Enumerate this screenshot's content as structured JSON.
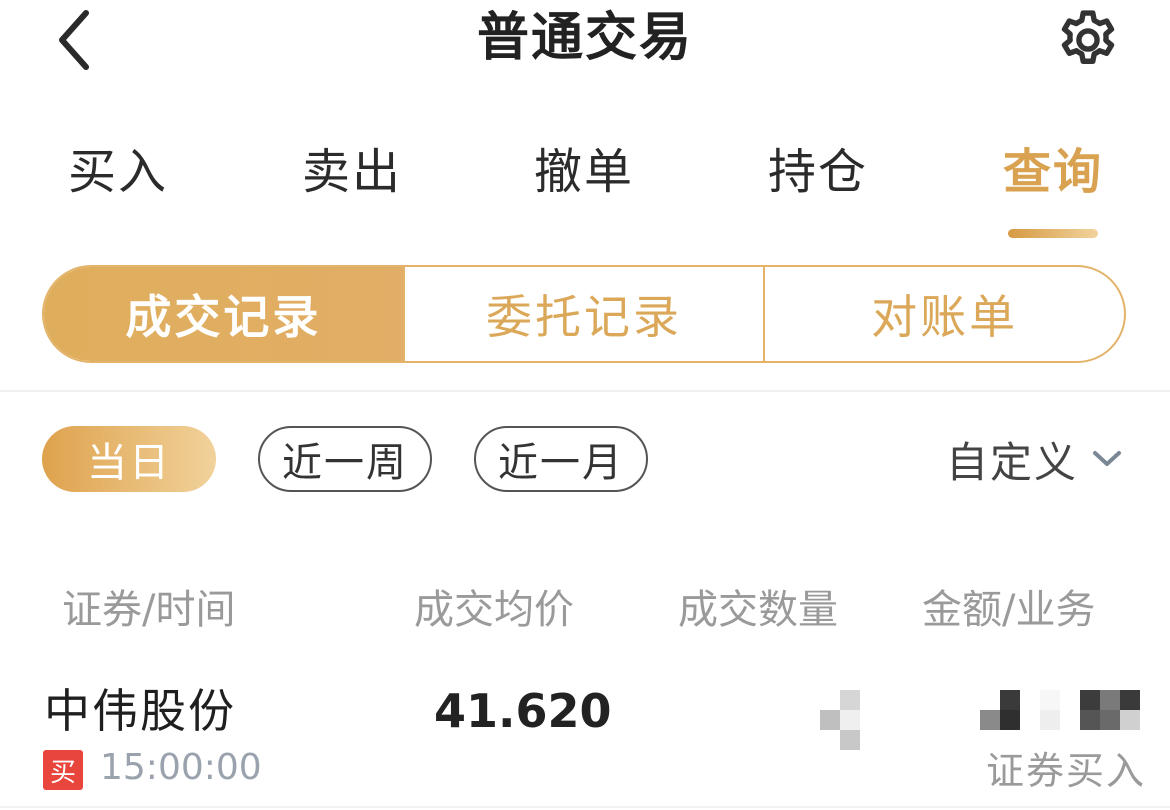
{
  "header": {
    "title": "普通交易",
    "back_icon": "chevron-left-icon",
    "settings_icon": "gear-icon"
  },
  "main_tabs": [
    {
      "label": "买入",
      "active": false
    },
    {
      "label": "卖出",
      "active": false
    },
    {
      "label": "撤单",
      "active": false
    },
    {
      "label": "持仓",
      "active": false
    },
    {
      "label": "查询",
      "active": true
    }
  ],
  "sub_tabs": [
    {
      "label": "成交记录",
      "active": true
    },
    {
      "label": "委托记录",
      "active": false
    },
    {
      "label": "对账单",
      "active": false
    }
  ],
  "date_filters": [
    {
      "label": "当日",
      "active": true
    },
    {
      "label": "近一周",
      "active": false
    },
    {
      "label": "近一月",
      "active": false
    }
  ],
  "custom_filter": {
    "label": "自定义",
    "icon": "chevron-down-icon"
  },
  "table": {
    "columns": [
      "证券/时间",
      "成交均价",
      "成交数量",
      "金额/业务"
    ],
    "rows": [
      {
        "name": "中伟股份",
        "side_badge": "买",
        "time": "15:00:00",
        "avg_price": "41.620",
        "business": "证券买入"
      }
    ]
  },
  "colors": {
    "accent": "#d9a251",
    "accent_light": "#f1d39c",
    "buy_badge": "#e8453c",
    "muted_text": "#9a9a9a"
  }
}
